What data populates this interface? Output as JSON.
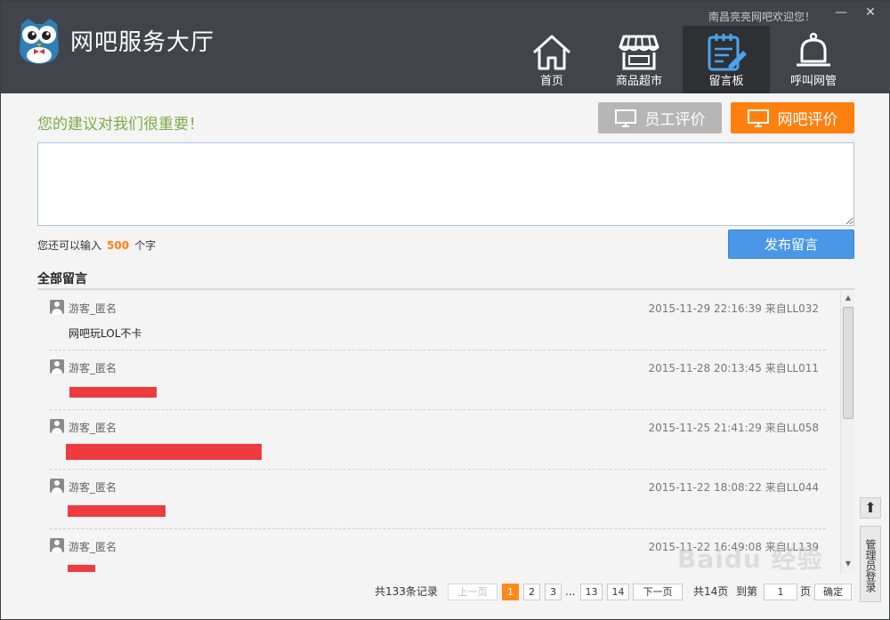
{
  "app": {
    "title": "网吧服务大厅",
    "welcome": "南昌亮亮网吧欢迎您！"
  },
  "window": {
    "min": "—",
    "close": "✕"
  },
  "nav": [
    {
      "label": "首页",
      "icon": "home-icon"
    },
    {
      "label": "商品超市",
      "icon": "store-icon"
    },
    {
      "label": "留言板",
      "icon": "message-board-icon",
      "active": true
    },
    {
      "label": "呼叫网管",
      "icon": "bell-icon"
    }
  ],
  "board": {
    "slogan": "您的建议对我们很重要！",
    "staff_eval": "员工评价",
    "cafe_eval": "网吧评价",
    "input_value": "",
    "remain_prefix": "您还可以输入",
    "remain_count": "500",
    "remain_suffix": "个字",
    "publish": "发布留言",
    "all_title": "全部留言"
  },
  "messages": [
    {
      "user": "游客_匿名",
      "time": "2015-11-29 22:16:39 来自LL032",
      "text": "网吧玩LOL不卡"
    },
    {
      "user": "游客_匿名",
      "time": "2015-11-28 20:13:45 来自LL011",
      "text": ""
    },
    {
      "user": "游客_匿名",
      "time": "2015-11-25 21:41:29 来自LL058",
      "text": ""
    },
    {
      "user": "游客_匿名",
      "time": "2015-11-22 18:08:22 来自LL044",
      "text": ""
    },
    {
      "user": "游客_匿名",
      "time": "2015-11-22 16:49:08 来自LL139",
      "text": ""
    }
  ],
  "pager": {
    "total": "共133条记录",
    "prev": "上一页",
    "pages": [
      "1",
      "2",
      "3"
    ],
    "ellipsis": "...",
    "tail_pages": [
      "13",
      "14"
    ],
    "next": "下一页",
    "page_count": "共14页",
    "goto": "到第",
    "goto_value": "1",
    "page_unit": "页",
    "confirm": "确定"
  },
  "side": {
    "up": "⬆",
    "admin": "管理员登录"
  },
  "watermark": "Baidu 经验",
  "colors": {
    "header": "#41444a",
    "accent_orange": "#ff7f0f",
    "accent_blue": "#4a97e8",
    "slogan_green": "#7cab46"
  }
}
